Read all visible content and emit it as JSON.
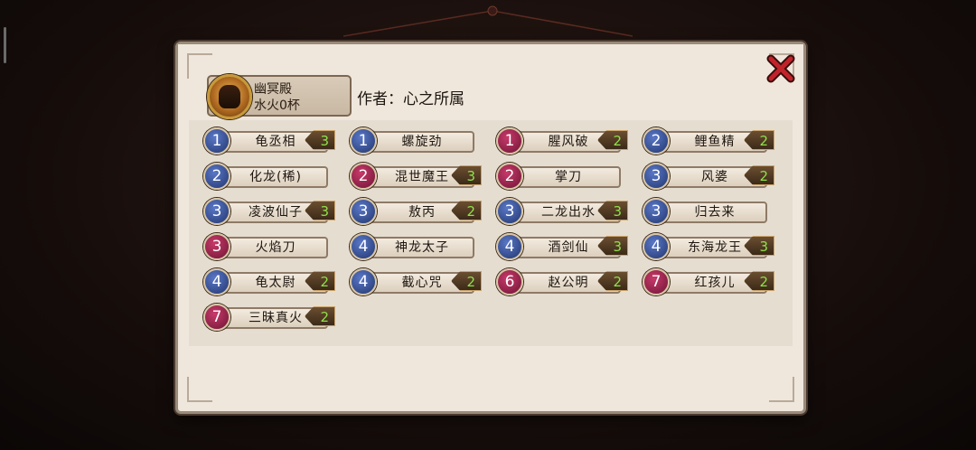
{
  "author_card": {
    "line1": "幽冥殿",
    "line2": "水火0杯"
  },
  "author_label": "作者：心之所属",
  "close_icon": "close-x-icon",
  "colors": {
    "blue_badge": "#2f4a96",
    "red_badge": "#9a1f4e",
    "count_text": "#8fe04a"
  },
  "cards": [
    {
      "cost": "1",
      "name": "龟丞相",
      "count": "3",
      "color": "blue"
    },
    {
      "cost": "1",
      "name": "螺旋劲",
      "count": "",
      "color": "blue"
    },
    {
      "cost": "1",
      "name": "腥风破",
      "count": "2",
      "color": "red"
    },
    {
      "cost": "2",
      "name": "鲤鱼精",
      "count": "2",
      "color": "blue"
    },
    {
      "cost": "2",
      "name": "化龙(稀)",
      "count": "",
      "color": "blue"
    },
    {
      "cost": "2",
      "name": "混世魔王",
      "count": "3",
      "color": "red"
    },
    {
      "cost": "2",
      "name": "掌刀",
      "count": "",
      "color": "red"
    },
    {
      "cost": "3",
      "name": "风婆",
      "count": "2",
      "color": "blue"
    },
    {
      "cost": "3",
      "name": "凌波仙子",
      "count": "3",
      "color": "blue"
    },
    {
      "cost": "3",
      "name": "敖丙",
      "count": "2",
      "color": "blue"
    },
    {
      "cost": "3",
      "name": "二龙出水",
      "count": "3",
      "color": "blue"
    },
    {
      "cost": "3",
      "name": "归去来",
      "count": "",
      "color": "blue"
    },
    {
      "cost": "3",
      "name": "火焰刀",
      "count": "",
      "color": "red"
    },
    {
      "cost": "4",
      "name": "神龙太子",
      "count": "",
      "color": "blue"
    },
    {
      "cost": "4",
      "name": "酒剑仙",
      "count": "3",
      "color": "blue"
    },
    {
      "cost": "4",
      "name": "东海龙王",
      "count": "3",
      "color": "blue"
    },
    {
      "cost": "4",
      "name": "龟太尉",
      "count": "2",
      "color": "blue"
    },
    {
      "cost": "4",
      "name": "截心咒",
      "count": "2",
      "color": "blue"
    },
    {
      "cost": "6",
      "name": "赵公明",
      "count": "2",
      "color": "red"
    },
    {
      "cost": "7",
      "name": "红孩儿",
      "count": "2",
      "color": "red"
    },
    {
      "cost": "7",
      "name": "三昧真火",
      "count": "2",
      "color": "red"
    }
  ]
}
